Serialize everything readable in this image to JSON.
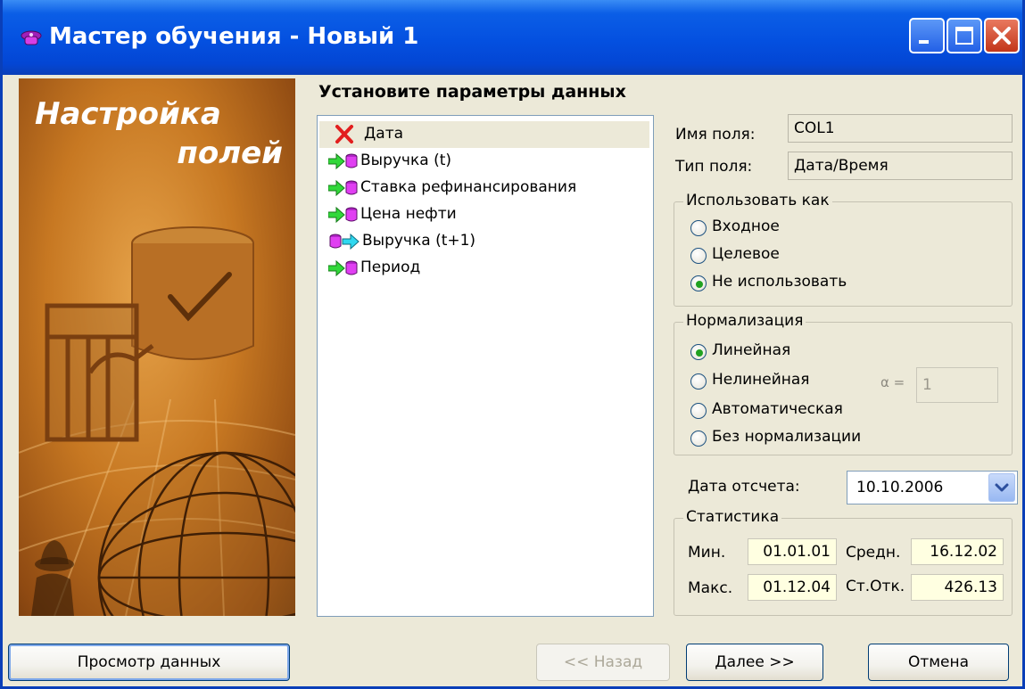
{
  "window": {
    "title": "Мастер обучения - Новый 1",
    "icon": "cap-icon",
    "colors": {
      "titlebar": "#0450e0",
      "close": "#c2361a",
      "face": "#ece9d8"
    }
  },
  "banner": {
    "title_line1": "Настройка",
    "title_line2": "полей"
  },
  "heading": "Установите параметры данных",
  "fields": [
    {
      "label": "Дата",
      "icon": "unused-x-icon",
      "selected": true
    },
    {
      "label": "Выручка (t)",
      "icon": "input-field-icon"
    },
    {
      "label": "Ставка рефинансирования",
      "icon": "input-field-icon"
    },
    {
      "label": "Цена нефти",
      "icon": "input-field-icon"
    },
    {
      "label": "Выручка (t+1)",
      "icon": "output-field-icon"
    },
    {
      "label": "Период",
      "icon": "input-field-icon"
    }
  ],
  "field_info": {
    "name_label": "Имя поля:",
    "name_value": "COL1",
    "type_label": "Тип поля:",
    "type_value": "Дата/Время"
  },
  "use_as": {
    "title": "Использовать как",
    "options": [
      "Входное",
      "Целевое",
      "Не использовать"
    ],
    "selected": "Не использовать"
  },
  "normalization": {
    "title": "Нормализация",
    "options": [
      "Линейная",
      "Нелинейная",
      "Автоматическая",
      "Без нормализации"
    ],
    "selected": "Линейная",
    "alpha_label": "α =",
    "alpha_value": "1"
  },
  "ref_date": {
    "label": "Дата отсчета:",
    "value": "10.10.2006"
  },
  "statistics": {
    "title": "Статистика",
    "min_label": "Мин.",
    "min_value": "01.01.01",
    "mean_label": "Средн.",
    "mean_value": "16.12.02",
    "max_label": "Макс.",
    "max_value": "01.12.04",
    "std_label": "Ст.Отк.",
    "std_value": "426.13"
  },
  "buttons": {
    "preview": "Просмотр данных",
    "back": "<< Назад",
    "next": "Далее >>",
    "cancel": "Отмена"
  }
}
